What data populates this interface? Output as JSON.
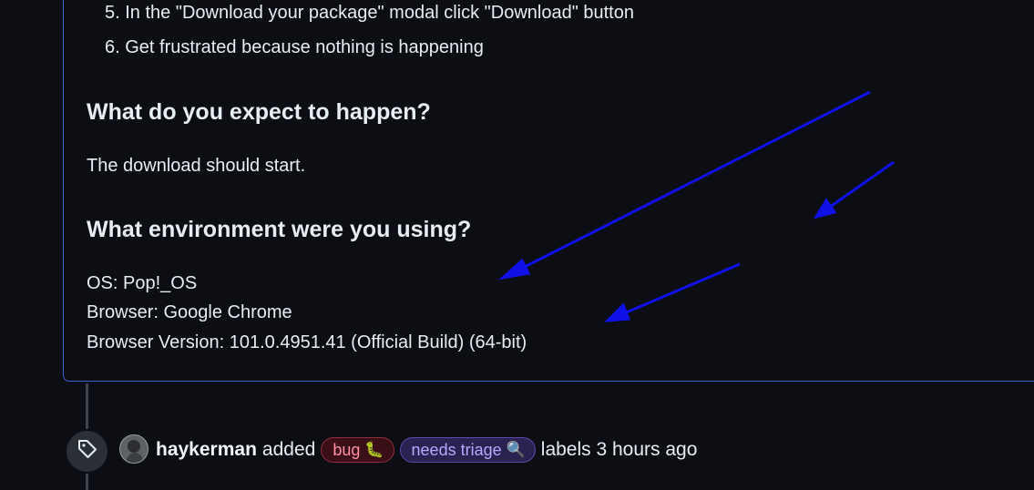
{
  "issue_body": {
    "steps": [
      {
        "number": "5.",
        "text": "In the \"Download your package\" modal click \"Download\" button"
      },
      {
        "number": "6.",
        "text": "Get frustrated because nothing is happening"
      }
    ],
    "expect_heading": "What do you expect to happen?",
    "expect_text": "The download should start.",
    "env_heading": "What environment were you using?",
    "env_lines": [
      "OS: Pop!_OS",
      "Browser: Google Chrome",
      "Browser Version: 101.0.4951.41 (Official Build) (64-bit)"
    ]
  },
  "timeline_event": {
    "icon": "tag-icon",
    "actor": "haykerman",
    "action": "added",
    "labels": [
      {
        "name": "bug",
        "emoji": "🐛",
        "color": "#ff8fa3"
      },
      {
        "name": "needs triage",
        "emoji": "🔍",
        "color": "#b8a9ff"
      }
    ],
    "suffix": "labels 3 hours ago"
  },
  "annotation_color": "#1010e8"
}
